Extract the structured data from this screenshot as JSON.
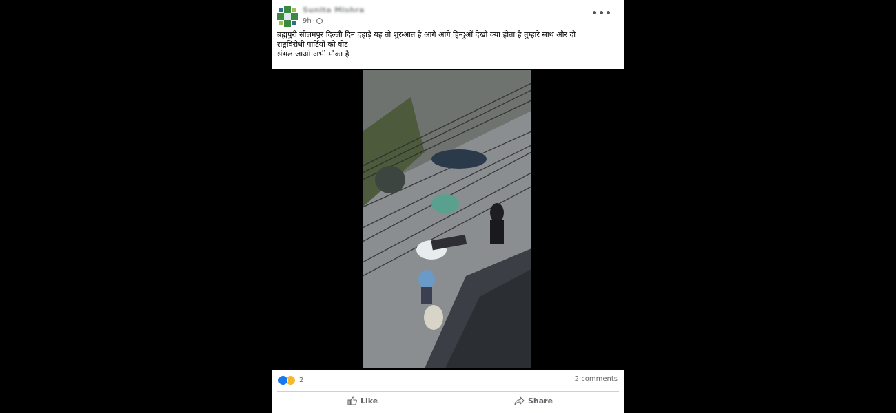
{
  "post": {
    "author": "Sunita Mishra",
    "time": "9h",
    "privacy_sep": "·",
    "more_label": "•••",
    "text_line1": "ब्रह्मपुरी सीलमपुर दिल्ली दिन दहाड़े यह तो शुरुआत है आगे आगे हिन्दुओं देखो क्या होता है तुम्हारे साथ और दो",
    "text_line2": "राष्ट्रविरोधी पार्टियों को वोट",
    "text_line3": "संभल जाओ अभी मौका है"
  },
  "footer": {
    "reaction_count": "2",
    "comments": "2 comments",
    "like_label": "Like",
    "share_label": "Share"
  },
  "icons": {
    "avatar": "avatar-icon",
    "privacy": "globe-icon",
    "like": "thumbs-up-icon",
    "share": "share-arrow-icon"
  },
  "colors": {
    "background": "#000000",
    "card": "#ffffff",
    "like_reaction": "#1877f2",
    "sad_reaction": "#f7b928",
    "secondary_text": "#65676b"
  }
}
